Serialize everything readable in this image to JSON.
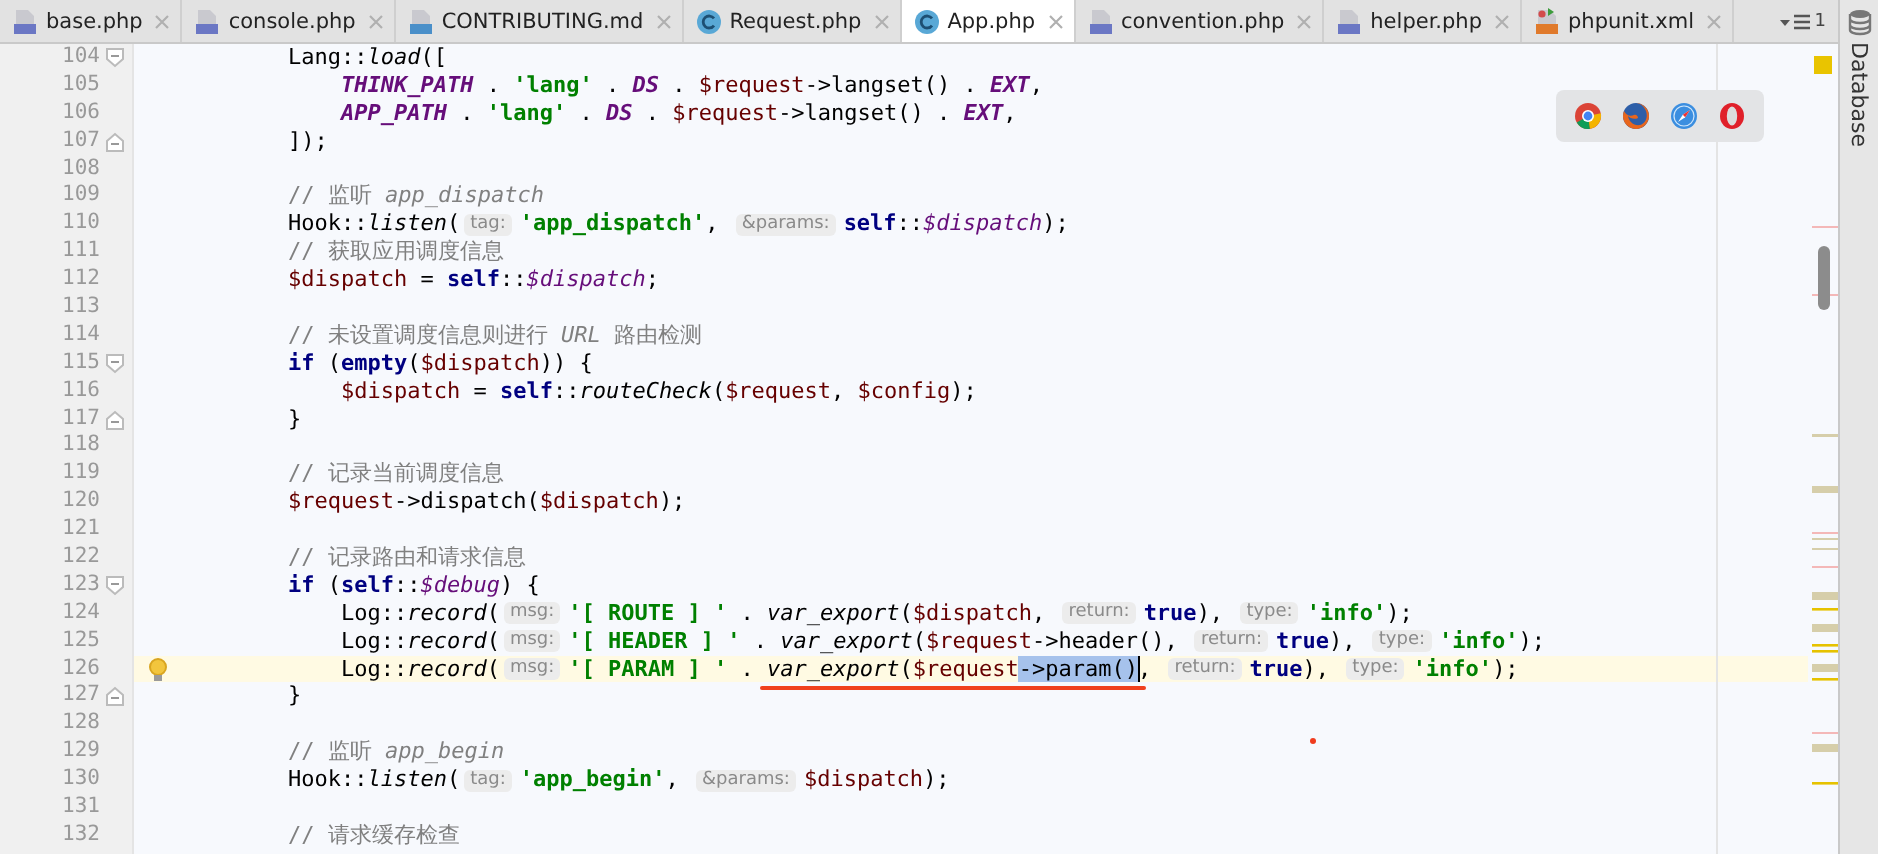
{
  "tabs": [
    {
      "label": "base.php",
      "kind": "php",
      "selected": false
    },
    {
      "label": "console.php",
      "kind": "php",
      "selected": false
    },
    {
      "label": "CONTRIBUTING.md",
      "kind": "md",
      "selected": false
    },
    {
      "label": "Request.php",
      "kind": "class",
      "selected": false
    },
    {
      "label": "App.php",
      "kind": "class",
      "selected": true
    },
    {
      "label": "convention.php",
      "kind": "php",
      "selected": false
    },
    {
      "label": "helper.php",
      "kind": "php",
      "selected": false
    },
    {
      "label": "phpunit.xml",
      "kind": "xml",
      "selected": false
    }
  ],
  "tab_overflow": {
    "count": "1"
  },
  "tool_strip": {
    "label": "Database"
  },
  "editor": {
    "lines": [
      {
        "number": "104",
        "fold_open": true,
        "tokens": [
          {
            "kind": "plain",
            "s": "        Lang::"
          },
          {
            "kind": "fn",
            "s": "load"
          },
          {
            "kind": "plain",
            "s": "(["
          }
        ]
      },
      {
        "number": "105",
        "tokens": [
          {
            "kind": "const",
            "s": "            THINK_PATH"
          },
          {
            "kind": "plain",
            "s": " . "
          },
          {
            "kind": "str",
            "s": "'lang'"
          },
          {
            "kind": "plain",
            "s": " . "
          },
          {
            "kind": "const",
            "s": "DS"
          },
          {
            "kind": "plain",
            "s": " . "
          },
          {
            "kind": "var",
            "s": "$request"
          },
          {
            "kind": "plain",
            "s": "->langset() . "
          },
          {
            "kind": "const",
            "s": "EXT"
          },
          {
            "kind": "plain",
            "s": ","
          }
        ]
      },
      {
        "number": "106",
        "tokens": [
          {
            "kind": "const",
            "s": "            APP_PATH"
          },
          {
            "kind": "plain",
            "s": " . "
          },
          {
            "kind": "str",
            "s": "'lang'"
          },
          {
            "kind": "plain",
            "s": " . "
          },
          {
            "kind": "const",
            "s": "DS"
          },
          {
            "kind": "plain",
            "s": " . "
          },
          {
            "kind": "var",
            "s": "$request"
          },
          {
            "kind": "plain",
            "s": "->langset() . "
          },
          {
            "kind": "const",
            "s": "EXT"
          },
          {
            "kind": "plain",
            "s": ","
          }
        ]
      },
      {
        "number": "107",
        "fold_close": true,
        "tokens": [
          {
            "kind": "plain",
            "s": "        ]);"
          }
        ]
      },
      {
        "number": "108"
      },
      {
        "number": "109",
        "tokens": [
          {
            "kind": "comment",
            "s": "        // 监听 "
          },
          {
            "kind": "comment_it",
            "s": "app_dispatch"
          }
        ]
      },
      {
        "number": "110",
        "tokens": [
          {
            "kind": "plain",
            "s": "        Hook::"
          },
          {
            "kind": "fn",
            "s": "listen"
          },
          {
            "kind": "plain",
            "s": "("
          },
          {
            "kind": "hint",
            "s": "tag:"
          },
          {
            "kind": "str",
            "s": "'app_dispatch'"
          },
          {
            "kind": "plain",
            "s": ", "
          },
          {
            "kind": "hint",
            "s": "&params:"
          },
          {
            "kind": "kw",
            "s": "self"
          },
          {
            "kind": "plain",
            "s": "::"
          },
          {
            "kind": "field",
            "s": "$dispatch"
          },
          {
            "kind": "plain",
            "s": ");"
          }
        ]
      },
      {
        "number": "111",
        "tokens": [
          {
            "kind": "comment",
            "s": "        // 获取应用调度信息"
          }
        ]
      },
      {
        "number": "112",
        "tokens": [
          {
            "kind": "var",
            "s": "        $dispatch"
          },
          {
            "kind": "plain",
            "s": " = "
          },
          {
            "kind": "kw",
            "s": "self"
          },
          {
            "kind": "plain",
            "s": "::"
          },
          {
            "kind": "field",
            "s": "$dispatch"
          },
          {
            "kind": "plain",
            "s": ";"
          }
        ]
      },
      {
        "number": "113"
      },
      {
        "number": "114",
        "tokens": [
          {
            "kind": "comment",
            "s": "        // 未设置调度信息则进行 "
          },
          {
            "kind": "comment_it",
            "s": "URL"
          },
          {
            "kind": "comment",
            "s": " 路由检测"
          }
        ]
      },
      {
        "number": "115",
        "fold_open": true,
        "tokens": [
          {
            "kind": "kw",
            "s": "        if"
          },
          {
            "kind": "plain",
            "s": " ("
          },
          {
            "kind": "kw",
            "s": "empty"
          },
          {
            "kind": "plain",
            "s": "("
          },
          {
            "kind": "var",
            "s": "$dispatch"
          },
          {
            "kind": "plain",
            "s": ")) {"
          }
        ]
      },
      {
        "number": "116",
        "tokens": [
          {
            "kind": "var",
            "s": "            $dispatch"
          },
          {
            "kind": "plain",
            "s": " = "
          },
          {
            "kind": "kw",
            "s": "self"
          },
          {
            "kind": "plain",
            "s": "::"
          },
          {
            "kind": "fn",
            "s": "routeCheck"
          },
          {
            "kind": "plain",
            "s": "("
          },
          {
            "kind": "var",
            "s": "$request"
          },
          {
            "kind": "plain",
            "s": ", "
          },
          {
            "kind": "var",
            "s": "$config"
          },
          {
            "kind": "plain",
            "s": ");"
          }
        ]
      },
      {
        "number": "117",
        "fold_close": true,
        "tokens": [
          {
            "kind": "plain",
            "s": "        }"
          }
        ]
      },
      {
        "number": "118"
      },
      {
        "number": "119",
        "tokens": [
          {
            "kind": "comment",
            "s": "        // 记录当前调度信息"
          }
        ]
      },
      {
        "number": "120",
        "tokens": [
          {
            "kind": "var",
            "s": "        $request"
          },
          {
            "kind": "plain",
            "s": "->dispatch("
          },
          {
            "kind": "var",
            "s": "$dispatch"
          },
          {
            "kind": "plain",
            "s": ");"
          }
        ]
      },
      {
        "number": "121"
      },
      {
        "number": "122",
        "tokens": [
          {
            "kind": "comment",
            "s": "        // 记录路由和请求信息"
          }
        ]
      },
      {
        "number": "123",
        "fold_open": true,
        "tokens": [
          {
            "kind": "kw",
            "s": "        if"
          },
          {
            "kind": "plain",
            "s": " ("
          },
          {
            "kind": "kw",
            "s": "self"
          },
          {
            "kind": "plain",
            "s": "::"
          },
          {
            "kind": "field",
            "s": "$debug"
          },
          {
            "kind": "plain",
            "s": ") {"
          }
        ]
      },
      {
        "number": "124",
        "tokens": [
          {
            "kind": "plain",
            "s": "            Log::"
          },
          {
            "kind": "fn",
            "s": "record"
          },
          {
            "kind": "plain",
            "s": "("
          },
          {
            "kind": "hint",
            "s": "msg:"
          },
          {
            "kind": "str",
            "s": "'[ ROUTE ] '"
          },
          {
            "kind": "plain",
            "s": " . "
          },
          {
            "kind": "fn",
            "s": "var_export"
          },
          {
            "kind": "plain",
            "s": "("
          },
          {
            "kind": "var",
            "s": "$dispatch"
          },
          {
            "kind": "plain",
            "s": ", "
          },
          {
            "kind": "hint",
            "s": "return:"
          },
          {
            "kind": "kw",
            "s": "true"
          },
          {
            "kind": "plain",
            "s": "), "
          },
          {
            "kind": "hint",
            "s": "type:"
          },
          {
            "kind": "str",
            "s": "'info'"
          },
          {
            "kind": "plain",
            "s": ");"
          }
        ]
      },
      {
        "number": "125",
        "tokens": [
          {
            "kind": "plain",
            "s": "            Log::"
          },
          {
            "kind": "fn",
            "s": "record"
          },
          {
            "kind": "plain",
            "s": "("
          },
          {
            "kind": "hint",
            "s": "msg:"
          },
          {
            "kind": "str",
            "s": "'[ HEADER ] '"
          },
          {
            "kind": "plain",
            "s": " . "
          },
          {
            "kind": "fn",
            "s": "var_export"
          },
          {
            "kind": "plain",
            "s": "("
          },
          {
            "kind": "var",
            "s": "$request"
          },
          {
            "kind": "plain",
            "s": "->header(), "
          },
          {
            "kind": "hint",
            "s": "return:"
          },
          {
            "kind": "kw",
            "s": "true"
          },
          {
            "kind": "plain",
            "s": "), "
          },
          {
            "kind": "hint",
            "s": "type:"
          },
          {
            "kind": "str",
            "s": "'info'"
          },
          {
            "kind": "plain",
            "s": ");"
          }
        ]
      },
      {
        "number": "126",
        "current": true,
        "bulb": true,
        "caret": true,
        "tokens": [
          {
            "kind": "plain",
            "s": "            Log::"
          },
          {
            "kind": "fn",
            "s": "record"
          },
          {
            "kind": "plain",
            "s": "("
          },
          {
            "kind": "hint",
            "s": "msg:"
          },
          {
            "kind": "str",
            "s": "'[ PARAM ] '"
          },
          {
            "kind": "plain",
            "s": " . "
          },
          {
            "kind": "fn",
            "s": "var_export",
            "underlined": true
          },
          {
            "kind": "plain",
            "s": "(",
            "underlined": true
          },
          {
            "kind": "var",
            "s": "$request",
            "underlined": true
          },
          {
            "kind": "sel",
            "s": "->param()",
            "underlined": true
          },
          {
            "kind": "plain",
            "s": ", "
          },
          {
            "kind": "hint",
            "s": "return:"
          },
          {
            "kind": "kw",
            "s": "true"
          },
          {
            "kind": "plain",
            "s": "), "
          },
          {
            "kind": "hint",
            "s": "type:"
          },
          {
            "kind": "str",
            "s": "'info'"
          },
          {
            "kind": "plain",
            "s": ");"
          }
        ]
      },
      {
        "number": "127",
        "fold_close": true,
        "tokens": [
          {
            "kind": "plain",
            "s": "        }"
          }
        ]
      },
      {
        "number": "128"
      },
      {
        "number": "129",
        "tokens": [
          {
            "kind": "comment",
            "s": "        // 监听 "
          },
          {
            "kind": "comment_it",
            "s": "app_begin"
          }
        ]
      },
      {
        "number": "130",
        "tokens": [
          {
            "kind": "plain",
            "s": "        Hook::"
          },
          {
            "kind": "fn",
            "s": "listen"
          },
          {
            "kind": "plain",
            "s": "("
          },
          {
            "kind": "hint",
            "s": "tag:"
          },
          {
            "kind": "str",
            "s": "'app_begin'"
          },
          {
            "kind": "plain",
            "s": ", "
          },
          {
            "kind": "hint",
            "s": "&params:"
          },
          {
            "kind": "var",
            "s": "$dispatch"
          },
          {
            "kind": "plain",
            "s": ");"
          }
        ]
      },
      {
        "number": "131"
      },
      {
        "number": "132",
        "tokens": [
          {
            "kind": "comment",
            "s": "        // 请求缓存检查"
          }
        ]
      }
    ]
  }
}
